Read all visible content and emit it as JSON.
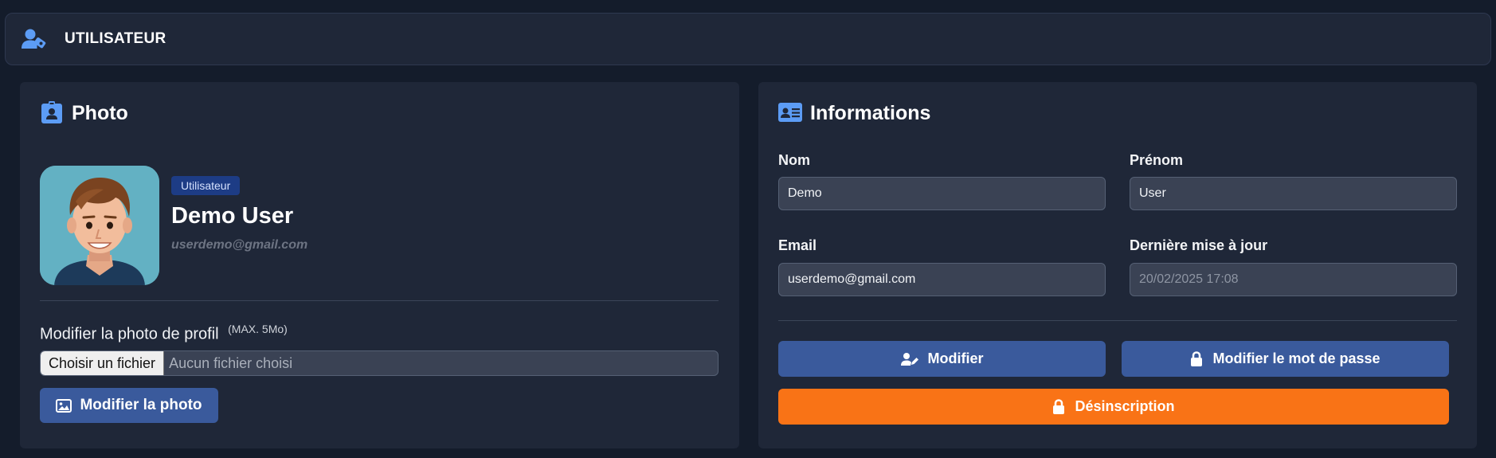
{
  "header": {
    "title": "UTILISATEUR",
    "icon": "user-gear-icon"
  },
  "colors": {
    "accent": "#5c9cf5",
    "primary_button": "#3a5a9c",
    "danger_button": "#f97316",
    "badge": "#1d3c85"
  },
  "photo_card": {
    "title": "Photo",
    "title_icon": "id-badge-icon",
    "role_badge": "Utilisateur",
    "user_name": "Demo User",
    "user_email": "userdemo@gmail.com",
    "upload_label": "Modifier la photo de profil",
    "upload_note": "(MAX. 5Mo)",
    "file_button": "Choisir un fichier",
    "file_status": "Aucun fichier choisi",
    "submit_button": "Modifier la photo"
  },
  "info_card": {
    "title": "Informations",
    "title_icon": "address-card-icon",
    "fields": {
      "nom": {
        "label": "Nom",
        "value": "Demo"
      },
      "prenom": {
        "label": "Prénom",
        "value": "User"
      },
      "email": {
        "label": "Email",
        "value": "userdemo@gmail.com"
      },
      "updated": {
        "label": "Dernière mise à jour",
        "value": "20/02/2025 17:08"
      }
    },
    "buttons": {
      "edit": "Modifier",
      "change_password": "Modifier le mot de passe",
      "unsubscribe": "Désinscription"
    }
  }
}
